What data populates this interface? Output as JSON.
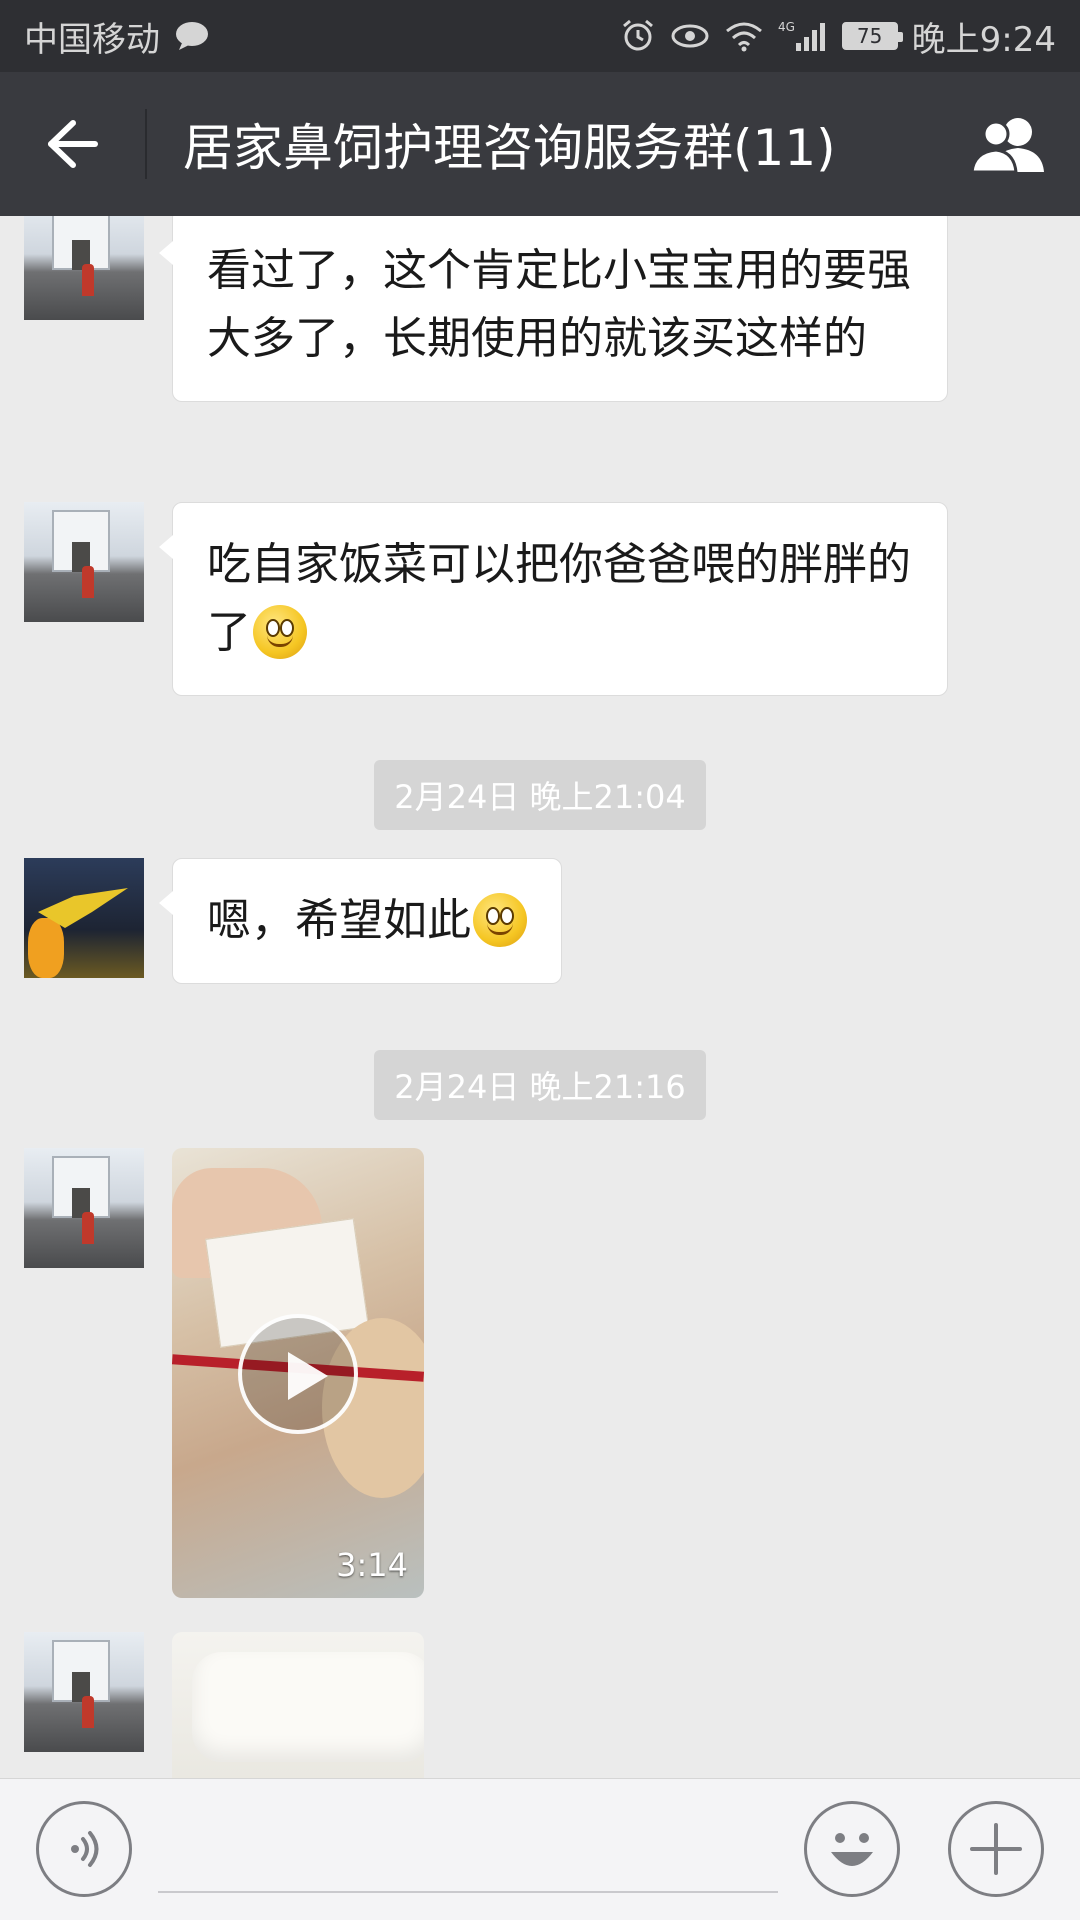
{
  "status_bar": {
    "carrier": "中国移动",
    "network": "4G",
    "battery": "75",
    "time": "晚上9:24"
  },
  "title_bar": {
    "title": "居家鼻饲护理咨询服务群(11)"
  },
  "messages": [
    {
      "type": "text",
      "text": "看过了，这个肯定比小宝宝用的要强大多了，长期使用的就该买这样的"
    },
    {
      "type": "text",
      "text": "吃自家饭菜可以把你爸爸喂的胖胖的了",
      "emoji": "smile-emoji"
    },
    {
      "type": "timestamp",
      "text": "2月24日 晚上21:04"
    },
    {
      "type": "text",
      "text": "嗯，希望如此",
      "emoji": "smile-emoji"
    },
    {
      "type": "timestamp",
      "text": "2月24日 晚上21:16"
    },
    {
      "type": "video",
      "duration": "3:14"
    },
    {
      "type": "video",
      "duration": ""
    }
  ],
  "icons": {
    "back": "back-arrow-icon",
    "members": "group-members-icon",
    "voice": "voice-icon",
    "emoji": "emoji-icon",
    "more": "plus-icon"
  },
  "colors": {
    "status_bar": "#2e2f33",
    "title_bar": "#393a3f",
    "chat_background": "#ebebeb",
    "bubble": "#ffffff",
    "timestamp_pill": "#d5d5d5"
  }
}
